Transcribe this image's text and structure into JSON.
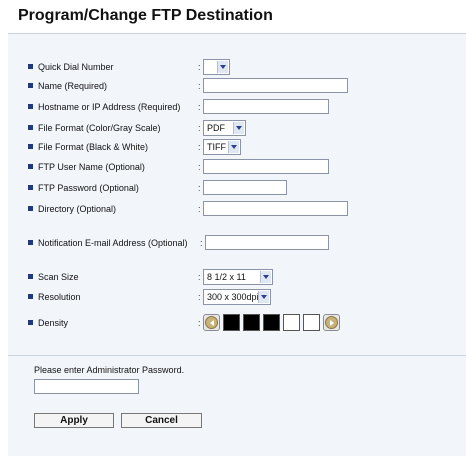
{
  "page": {
    "title": "Program/Change FTP Destination"
  },
  "form": {
    "quick_dial": {
      "label": "Quick Dial Number",
      "value": ""
    },
    "name": {
      "label": "Name (Required)",
      "value": ""
    },
    "hostname": {
      "label": "Hostname or IP Address (Required)",
      "value": ""
    },
    "file_format_color": {
      "label": "File Format (Color/Gray Scale)",
      "value": "PDF"
    },
    "file_format_bw": {
      "label": "File Format (Black & White)",
      "value": "TIFF"
    },
    "ftp_user": {
      "label": "FTP User Name (Optional)",
      "value": ""
    },
    "ftp_password": {
      "label": "FTP Password (Optional)",
      "value": ""
    },
    "directory": {
      "label": "Directory (Optional)",
      "value": ""
    },
    "notification_email": {
      "label": "Notification E-mail Address (Optional)",
      "value": ""
    },
    "scan_size": {
      "label": "Scan Size",
      "value": "8 1/2 x 11"
    },
    "resolution": {
      "label": "Resolution",
      "value": "300 x 300dpi"
    },
    "density": {
      "label": "Density",
      "level": 3,
      "max": 5
    },
    "colon": ":"
  },
  "admin": {
    "prompt": "Please enter Administrator Password.",
    "password": ""
  },
  "buttons": {
    "apply": "Apply",
    "cancel": "Cancel"
  },
  "colors": {
    "bullet": "#20397a",
    "panel_bg": "#f2f5fa",
    "dark_step": "#000000",
    "light_step": "#ffffff"
  },
  "icons": {
    "density_decrease": "left-arrow-round-icon",
    "density_increase": "right-arrow-round-icon",
    "select_arrow": "chevron-down-icon"
  }
}
